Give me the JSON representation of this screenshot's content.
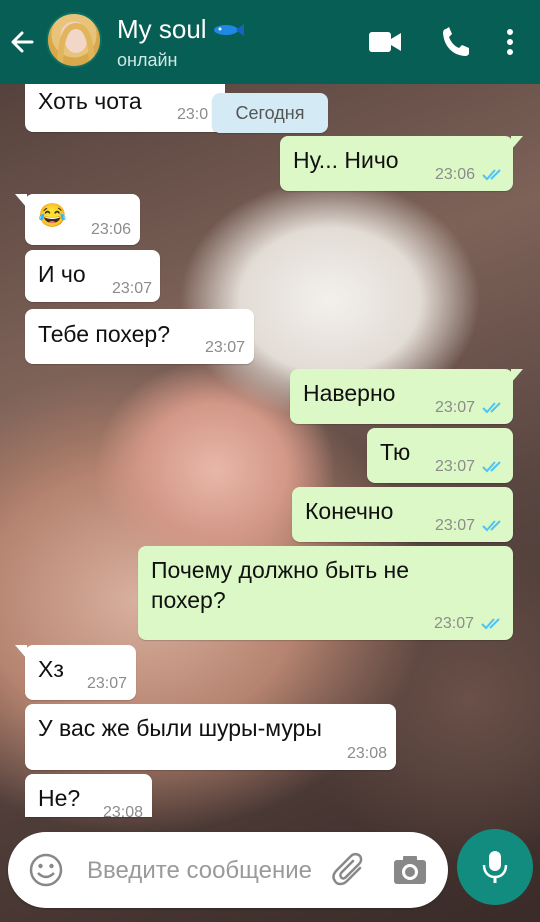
{
  "header": {
    "contact_name": "My soul",
    "status": "онлайн",
    "name_emoji_icon": "fish-icon",
    "icons": [
      "back-arrow-icon",
      "video-call-icon",
      "phone-icon",
      "more-vert-icon"
    ]
  },
  "date_chip": "Сегодня",
  "messages": [
    {
      "dir": "in",
      "text": "Хоть чота",
      "time": "23:0"
    },
    {
      "dir": "out",
      "text": "Ну... Ничо",
      "time": "23:06"
    },
    {
      "dir": "in",
      "text": "😂",
      "time": "23:06"
    },
    {
      "dir": "in",
      "text": "И чо",
      "time": "23:07"
    },
    {
      "dir": "in",
      "text": "Тебе похер?",
      "time": "23:07"
    },
    {
      "dir": "out",
      "text": "Наверно",
      "time": "23:07"
    },
    {
      "dir": "out",
      "text": "Тю",
      "time": "23:07"
    },
    {
      "dir": "out",
      "text": "Конечно",
      "time": "23:07"
    },
    {
      "dir": "out",
      "text_line1": "Почему должно быть не",
      "text_line2": "похер?",
      "time": "23:07"
    },
    {
      "dir": "in",
      "text": "Хз",
      "time": "23:07"
    },
    {
      "dir": "in",
      "text": "У вас же были шуры-муры",
      "time": "23:08"
    },
    {
      "dir": "in",
      "text": "Не?",
      "time": "23:08"
    }
  ],
  "composer": {
    "placeholder": "Введите сообщение",
    "icons": [
      "emoji-icon",
      "attach-icon",
      "camera-icon",
      "mic-icon"
    ]
  },
  "colors": {
    "appbar": "#075e54",
    "outgoing_bubble": "#dcf8c6",
    "incoming_bubble": "#ffffff",
    "read_ticks": "#4fc3f7",
    "mic_button": "#128c7e"
  }
}
